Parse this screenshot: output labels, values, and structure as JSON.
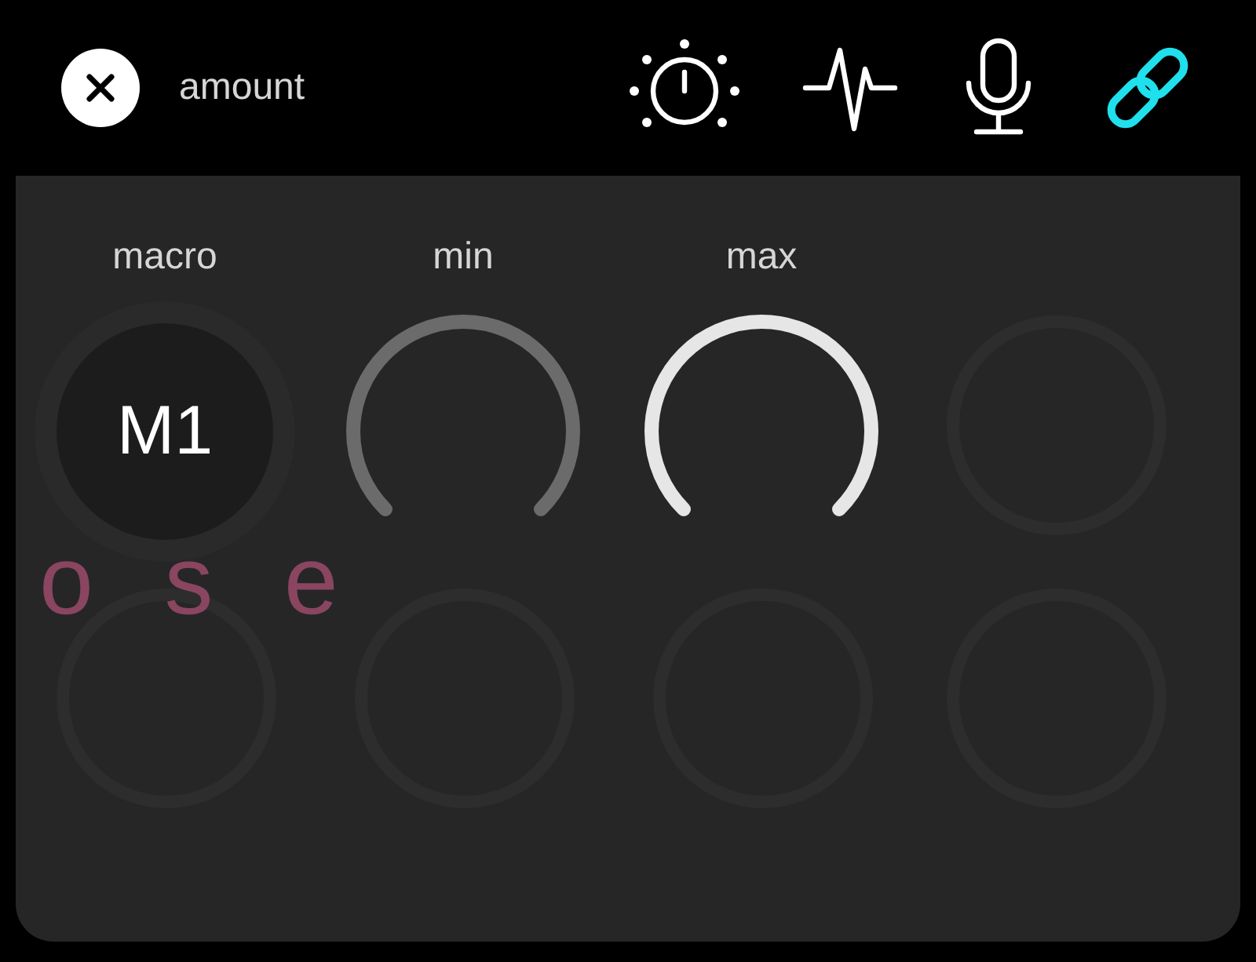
{
  "header": {
    "title": "amount"
  },
  "tabs": [
    {
      "kind": "knob",
      "selected": false
    },
    {
      "kind": "pulse",
      "selected": false
    },
    {
      "kind": "mic",
      "selected": false
    },
    {
      "kind": "link",
      "selected": true
    }
  ],
  "controls": [
    {
      "kind": "macro",
      "label": "macro",
      "value": "M1"
    },
    {
      "kind": "arc",
      "label": "min",
      "active": false
    },
    {
      "kind": "arc",
      "label": "max",
      "active": true
    }
  ],
  "background_text": "o s e"
}
